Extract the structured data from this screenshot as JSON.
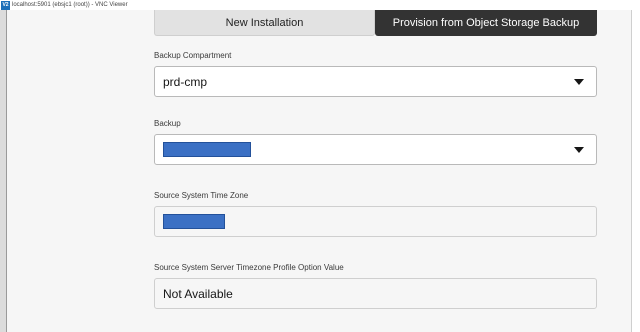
{
  "window": {
    "title": "localhost:5901 (ebsjc1 (root)) - VNC Viewer",
    "logo_text": "V2"
  },
  "tabs": [
    {
      "label": "New Installation",
      "selected": false
    },
    {
      "label": "Provision from Object Storage Backup",
      "selected": true
    }
  ],
  "form": {
    "backup_compartment": {
      "label": "Backup Compartment",
      "value": "prd-cmp"
    },
    "backup": {
      "label": "Backup",
      "value": ""
    },
    "source_time_zone": {
      "label": "Source System Time Zone",
      "value": ""
    },
    "server_timezone_profile": {
      "label": "Source System Server Timezone Profile Option Value",
      "value": "Not Available"
    }
  },
  "colors": {
    "selected_tab": "#333333",
    "unselected_tab": "#e2e2e2",
    "redaction": "#3b70c4"
  }
}
